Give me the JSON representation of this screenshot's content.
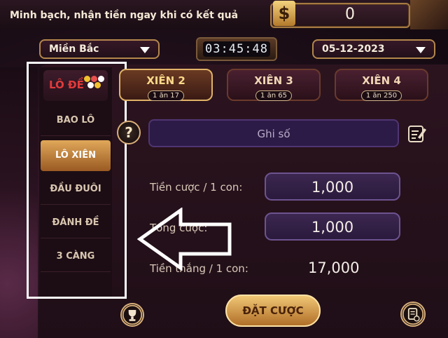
{
  "header": {
    "slogan": "Minh bạch, nhận tiền ngay khi có kết quả",
    "currency_symbol": "$",
    "balance": "0"
  },
  "filters": {
    "region": "Miền Bắc",
    "countdown": "03:45:48",
    "date": "05-12-2023"
  },
  "sidebar": {
    "logo": "LÔ ĐỀ",
    "items": [
      {
        "label": "BAO LÔ",
        "active": false
      },
      {
        "label": "LÔ XIÊN",
        "active": true
      },
      {
        "label": "ĐẦU ĐUÔI",
        "active": false
      },
      {
        "label": "ĐÁNH ĐỀ",
        "active": false
      },
      {
        "label": "3 CÀNG",
        "active": false
      }
    ]
  },
  "tabs": [
    {
      "title": "XIÊN 2",
      "odds": "1 ăn 17",
      "active": true
    },
    {
      "title": "XIÊN 3",
      "odds": "1 ăn 65",
      "active": false
    },
    {
      "title": "XIÊN 4",
      "odds": "1 ăn 250",
      "active": false
    }
  ],
  "form": {
    "help_symbol": "?",
    "note_placeholder": "Ghi số",
    "stake_label": "Tiền cược / 1 con:",
    "stake_value": "1,000",
    "total_label": "Tổng cược:",
    "total_value": "1,000",
    "win_label": "Tiền thắng / 1 con:",
    "win_value": "17,000"
  },
  "actions": {
    "place_bet": "ĐẶT CƯỢC"
  },
  "icons": {
    "help": "question-icon",
    "edit": "edit-note-icon",
    "trophy": "trophy-icon",
    "history": "history-icon",
    "dropdown": "chevron-down-icon",
    "annotation": "left-arrow-annotation"
  },
  "colors": {
    "accent_gold": "#e0b368",
    "active_tab": "#ffd98a",
    "input_bg": "#2d1b47",
    "logo_red": "#e23b3b"
  }
}
